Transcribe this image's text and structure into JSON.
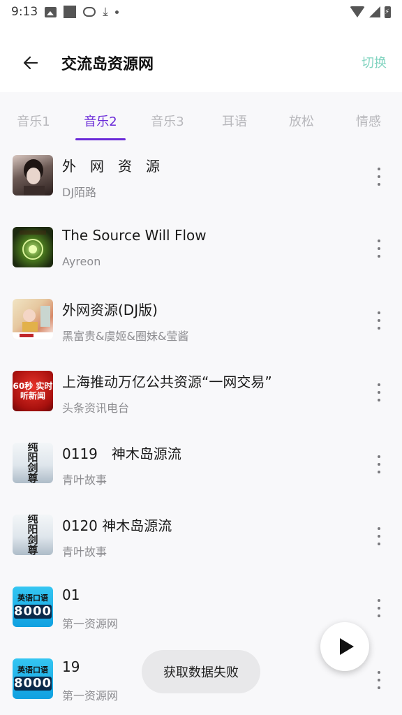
{
  "status_bar": {
    "time": "9:13",
    "left_icons": [
      "image-icon",
      "square-icon",
      "cloud-icon",
      "download-icon",
      "dot-icon"
    ],
    "right_icons": [
      "wifi-icon",
      "signal-icon",
      "battery-charging-icon"
    ]
  },
  "app_bar": {
    "back_icon": "arrow-left-icon",
    "title": "交流岛资源网",
    "switch_label": "切换"
  },
  "tabs": [
    {
      "label": "音乐1",
      "active": false
    },
    {
      "label": "音乐2",
      "active": true
    },
    {
      "label": "音乐3",
      "active": false
    },
    {
      "label": "耳语",
      "active": false
    },
    {
      "label": "放松",
      "active": false
    },
    {
      "label": "情感",
      "active": false
    }
  ],
  "accent_color": "#6a2ad8",
  "switch_color": "#82d4c0",
  "tracks": [
    {
      "title": "外　网　资　源",
      "artist": "DJ陌路",
      "art": "portrait-photo"
    },
    {
      "title": "The Source Will Flow",
      "artist": "Ayreon",
      "art": "green-album-art"
    },
    {
      "title": "外网资源(DJ版)",
      "artist": "黑富贵&虞姬&圈妹&莹酱",
      "art": "colorful-album-art"
    },
    {
      "title": "上海推动万亿公共资源“一网交易”",
      "artist": "头条资讯电台",
      "art": "red-news-logo",
      "art_text": "60秒 实时听新闻"
    },
    {
      "title": "0119　神木岛源流",
      "artist": "青叶故事",
      "art": "ink-calligraphy-art",
      "art_text": "纯阳剑尊"
    },
    {
      "title": "0120  神木岛源流",
      "artist": "青叶故事",
      "art": "ink-calligraphy-art",
      "art_text": "纯阳剑尊"
    },
    {
      "title": "01",
      "artist": "第一资源网",
      "art": "english-course-art",
      "art_text": "英语口语",
      "art_number": "8000"
    },
    {
      "title": "19",
      "artist": "第一资源网",
      "art": "english-course-art",
      "art_text": "英语口语",
      "art_number": "8000"
    }
  ],
  "more_icon": "more-vertical-icon",
  "fab_icon": "play-icon",
  "toast": "获取数据失败"
}
